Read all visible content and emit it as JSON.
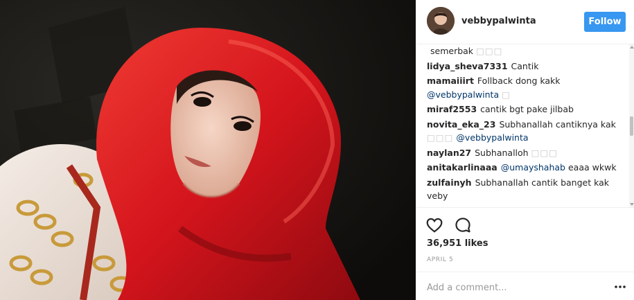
{
  "post": {
    "username": "vebbypalwinta",
    "follow_label": "Follow",
    "likes": "36,951 likes",
    "date": "APRIL 5",
    "comment_placeholder": "Add a comment..."
  },
  "comments": [
    {
      "user": "",
      "text": "semerbak",
      "emoji": "□□□",
      "mention": ""
    },
    {
      "user": "lidya_sheva7331",
      "text": "Cantik",
      "emoji": "",
      "mention": ""
    },
    {
      "user": "mamaiiirt",
      "text": "Follback dong kakk",
      "emoji": "□",
      "mention": "@vebbypalwinta"
    },
    {
      "user": "miraf2553",
      "text": "cantik bgt pake jilbab",
      "emoji": "",
      "mention": ""
    },
    {
      "user": "novita_eka_23",
      "text": "Subhanallah cantiknya kak",
      "emoji": "□□□",
      "mention": "@vebbypalwinta"
    },
    {
      "user": "naylan27",
      "text": "Subhanalloh",
      "emoji": "□□□",
      "mention": ""
    },
    {
      "user": "anitakarlinaaa",
      "text": "eaaa wkwk",
      "emoji": "",
      "mention": "@umayshahab"
    },
    {
      "user": "zulfainyh",
      "text": "Subhanallah cantik banget kak veby",
      "emoji": "",
      "mention": ""
    }
  ],
  "icons": {
    "like": "heart-icon",
    "comment": "speech-bubble-icon",
    "more": "more-options-icon"
  },
  "colors": {
    "follow_bg": "#3897f0",
    "mention": "#003569",
    "hijab": "#d4141c"
  }
}
